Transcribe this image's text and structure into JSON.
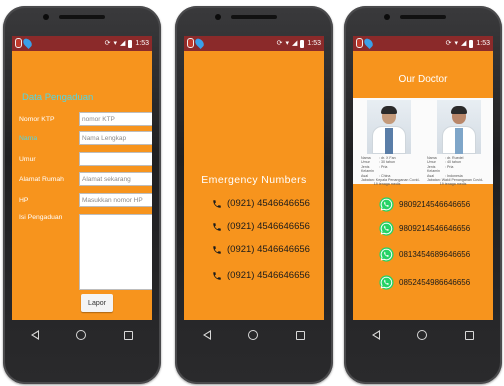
{
  "status": {
    "time": "1:53"
  },
  "form": {
    "title": "Data Pengaduan",
    "fields": [
      {
        "label": "Nomor KTP",
        "placeholder": "nomor KTP"
      },
      {
        "label": "Nama",
        "placeholder": "Nama Lengkap"
      },
      {
        "label": "Umur",
        "placeholder": ""
      },
      {
        "label": "Alamat Rumah",
        "placeholder": "Alamat sekarang"
      },
      {
        "label": "HP",
        "placeholder": "Masukkan nomor HP"
      }
    ],
    "textarea_label": "Isi Pengaduan",
    "submit": "Lapor"
  },
  "emergency": {
    "title": "Emergency Numbers",
    "numbers": [
      "(0921) 4546646656",
      "(0921) 4546646656",
      "(0921) 4546646656",
      "(0921) 4546646656"
    ]
  },
  "doctors": {
    "title": "Our Doctor",
    "cards": [
      {
        "rows": [
          [
            "Nama",
            ": dr. X Fan"
          ],
          [
            "Umur",
            ": 30 tahun"
          ],
          [
            "Jenis Kelamin",
            ": Pria"
          ],
          [
            "Asal",
            ": China"
          ],
          [
            "Jabatan",
            ": Kepala Penanganan Covid-19 tenaga medis"
          ]
        ]
      },
      {
        "rows": [
          [
            "Nama",
            ": dr. Ruedel"
          ],
          [
            "Umur",
            ": 40 tahun"
          ],
          [
            "Jenis Kelamin",
            ": Pria"
          ],
          [
            "Asal",
            ": Indonesia"
          ],
          [
            "Jabatan",
            ": Wakil Penanganan Covid-19 tenaga medis"
          ]
        ]
      }
    ],
    "whatsapp": [
      "9809214546646656",
      "9809214546646656",
      "0813454689646656",
      "0852454986646656"
    ]
  },
  "colors": {
    "screen": "#f7941d",
    "statusbar": "#8b2a2a",
    "accent": "#4fd8e6",
    "whatsapp": "#25d366"
  }
}
